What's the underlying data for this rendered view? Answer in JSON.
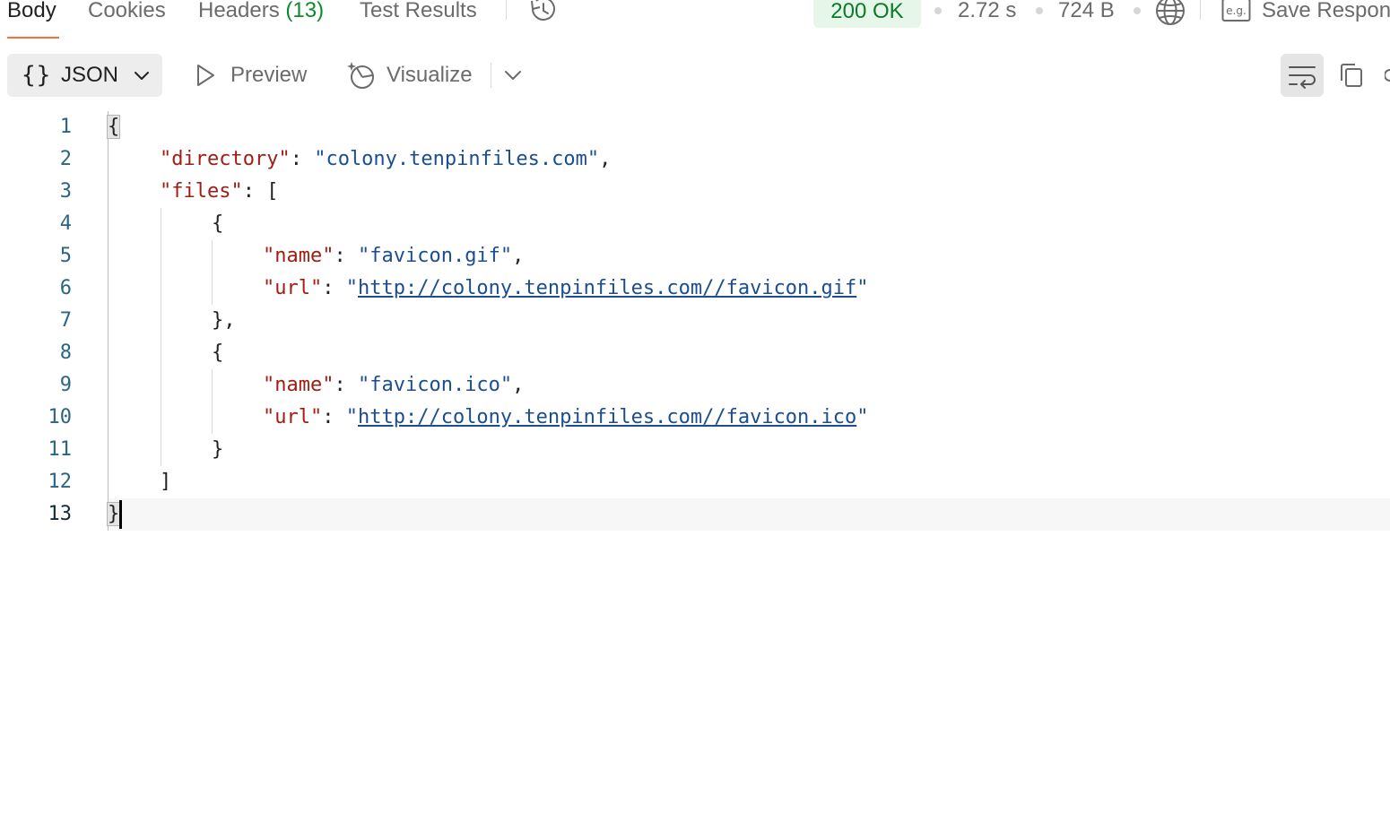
{
  "tabs": [
    {
      "label": "Body",
      "active": true
    },
    {
      "label": "Cookies"
    },
    {
      "label": "Headers",
      "count": "(13)"
    },
    {
      "label": "Test Results"
    }
  ],
  "status": {
    "code_text": "200 OK",
    "time": "2.72 s",
    "size": "724 B",
    "save_label": "Save Respon",
    "status_color": "#0b7a2a"
  },
  "toolbar": {
    "format_braces": "{}",
    "format_label": "JSON",
    "preview_label": "Preview",
    "visualize_label": "Visualize"
  },
  "icons": {
    "history": "history-icon",
    "globe": "globe-icon",
    "example": "example-icon",
    "wrap": "wrap-lines-icon",
    "copy": "copy-icon"
  },
  "editor": {
    "line_numbers": [
      "1",
      "2",
      "3",
      "4",
      "5",
      "6",
      "7",
      "8",
      "9",
      "10",
      "11",
      "12",
      "13"
    ],
    "open_brace": "{",
    "close_brace": "}",
    "key_directory": "\"directory\"",
    "val_directory": "\"colony.tenpinfiles.com\"",
    "key_files": "\"files\"",
    "file1_key_name": "\"name\"",
    "file1_name": "\"favicon.gif\"",
    "file1_key_url": "\"url\"",
    "file1_url": "http://colony.tenpinfiles.com//favicon.gif",
    "file2_key_name": "\"name\"",
    "file2_name": "\"favicon.ico\"",
    "file2_key_url": "\"url\"",
    "file2_url": "http://colony.tenpinfiles.com//favicon.ico"
  },
  "colors": {
    "accent": "#ff6c37",
    "json_key": "#a11d14",
    "json_string": "#1b4d93"
  }
}
